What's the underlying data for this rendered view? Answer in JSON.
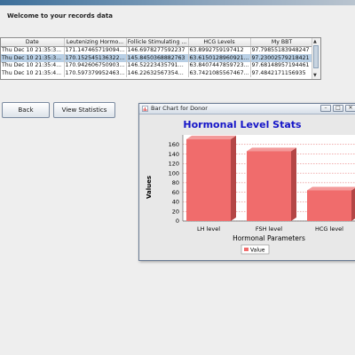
{
  "main": {
    "title": "Welcome to your records data"
  },
  "table": {
    "columns": [
      "Date",
      "Leutenizing Hormo...",
      "Follicle Stimulating ...",
      "HCG Levels",
      "My BBT"
    ],
    "rows": [
      [
        "Thu Dec 10 21:35:3...",
        "171.147465719094...",
        "146.6978277592237",
        "63.8992759197412",
        "97.79855183948247"
      ],
      [
        "Thu Dec 10 21:35:3...",
        "170.152545136322...",
        "145.8450368882763",
        "63.6150128960921...",
        "97.23002579218421"
      ],
      [
        "Thu Dec 10 21:35:4...",
        "170.942606750903...",
        "146.5222343579118...",
        "63.8407447859723...",
        "97.68148957194461"
      ],
      [
        "Thu Dec 10 21:35:4...",
        "170.597379952463...",
        "146.2263256735402...",
        "63.7421085567467...",
        "97.4842171156935"
      ]
    ],
    "selected_row": 1
  },
  "buttons": {
    "back": "Back",
    "view_statistics": "View Statistics"
  },
  "chart_window": {
    "title": "Bar Chart for Donor",
    "min_glyph": "–",
    "max_glyph": "□",
    "close_glyph": "✕"
  },
  "chart_data": {
    "type": "bar",
    "title": "Hormonal Level Stats",
    "xlabel": "Hormonal Parameters",
    "ylabel": "Values",
    "categories": [
      "LH level",
      "FSH level",
      "HCG level"
    ],
    "series": [
      {
        "name": "Value",
        "values": [
          171,
          146,
          64
        ],
        "color": "#f06c6c"
      }
    ],
    "ylim": [
      0,
      180
    ],
    "yticks": [
      0,
      20,
      40,
      60,
      80,
      100,
      120,
      140,
      160
    ],
    "grid": true,
    "legend": "bottom"
  },
  "colors": {
    "chart_title": "#1515c8",
    "bar": "#f06c6c",
    "bar_dark": "#b44646",
    "grid": "#e06060"
  }
}
